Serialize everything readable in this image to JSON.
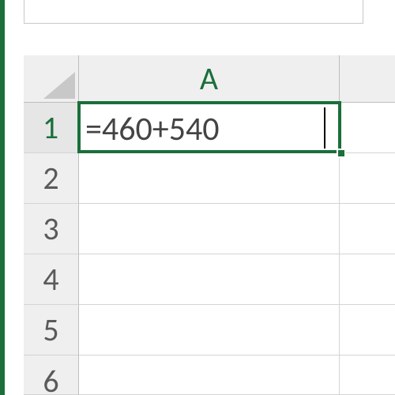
{
  "app": "Excel",
  "columns": [
    "A"
  ],
  "rows": [
    "1",
    "2",
    "3",
    "4",
    "5",
    "6"
  ],
  "active_cell": {
    "ref": "A1",
    "row": 1,
    "col": "A",
    "value": "=460+540",
    "editing": true
  },
  "cells": {
    "A1": "=460+540",
    "A2": "",
    "A3": "",
    "A4": "",
    "A5": "",
    "A6": ""
  },
  "colors": {
    "accent": "#1b6f3a",
    "header_bg": "#efefef",
    "grid_line": "#d4d4d4"
  }
}
